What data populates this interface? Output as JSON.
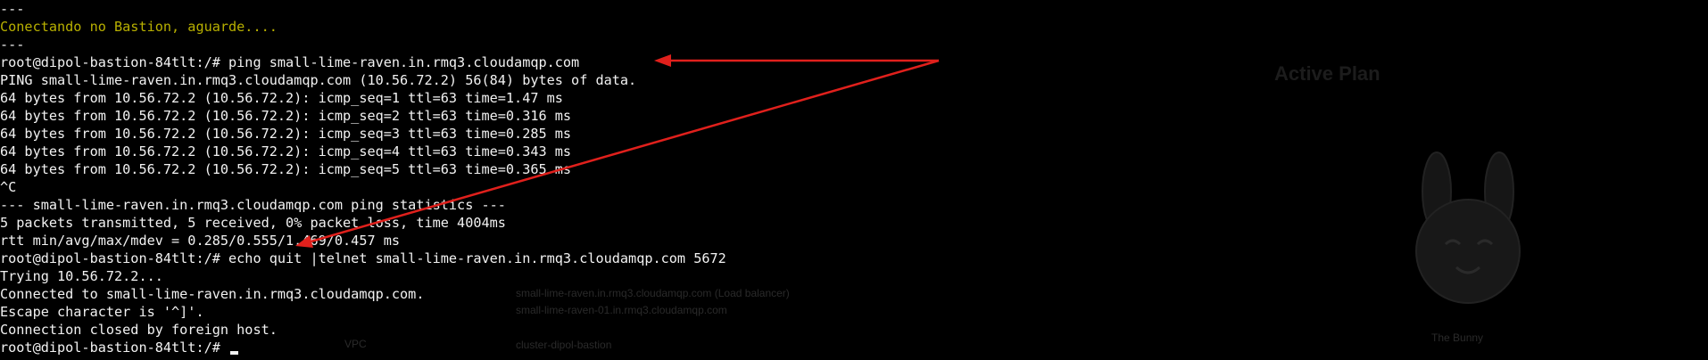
{
  "terminal": {
    "lines": [
      {
        "text": "---",
        "style": "normal"
      },
      {
        "text": "Conectando no Bastion, aguarde....",
        "style": "yellow"
      },
      {
        "text": "---",
        "style": "normal"
      },
      {
        "text": "root@dipol-bastion-84tlt:/# ping small-lime-raven.in.rmq3.cloudamqp.com",
        "style": "normal"
      },
      {
        "text": "PING small-lime-raven.in.rmq3.cloudamqp.com (10.56.72.2) 56(84) bytes of data.",
        "style": "normal"
      },
      {
        "text": "64 bytes from 10.56.72.2 (10.56.72.2): icmp_seq=1 ttl=63 time=1.47 ms",
        "style": "normal"
      },
      {
        "text": "64 bytes from 10.56.72.2 (10.56.72.2): icmp_seq=2 ttl=63 time=0.316 ms",
        "style": "normal"
      },
      {
        "text": "64 bytes from 10.56.72.2 (10.56.72.2): icmp_seq=3 ttl=63 time=0.285 ms",
        "style": "normal"
      },
      {
        "text": "64 bytes from 10.56.72.2 (10.56.72.2): icmp_seq=4 ttl=63 time=0.343 ms",
        "style": "normal"
      },
      {
        "text": "64 bytes from 10.56.72.2 (10.56.72.2): icmp_seq=5 ttl=63 time=0.365 ms",
        "style": "normal"
      },
      {
        "text": "^C",
        "style": "normal"
      },
      {
        "text": "--- small-lime-raven.in.rmq3.cloudamqp.com ping statistics ---",
        "style": "normal"
      },
      {
        "text": "5 packets transmitted, 5 received, 0% packet loss, time 4004ms",
        "style": "normal"
      },
      {
        "text": "rtt min/avg/max/mdev = 0.285/0.555/1.469/0.457 ms",
        "style": "normal"
      },
      {
        "text": "root@dipol-bastion-84tlt:/# echo quit |telnet small-lime-raven.in.rmq3.cloudamqp.com 5672",
        "style": "normal"
      },
      {
        "text": "Trying 10.56.72.2...",
        "style": "normal"
      },
      {
        "text": "Connected to small-lime-raven.in.rmq3.cloudamqp.com.",
        "style": "normal"
      },
      {
        "text": "Escape character is '^]'.",
        "style": "normal"
      },
      {
        "text": "Connection closed by foreign host.",
        "style": "normal"
      },
      {
        "text": "root@dipol-bastion-84tlt:/# ",
        "style": "prompt"
      }
    ]
  },
  "background_page": {
    "title": "Active Plan",
    "faint_texts": [
      "small-lime-raven.in.rmq3.cloudamqp.com (Load balancer)",
      "small-lime-raven-01.in.rmq3.cloudamqp.com",
      "VPC",
      "cluster-dipol-bastion",
      "The Bunny"
    ]
  },
  "colors": {
    "terminal_background": "#000000",
    "terminal_text": "#f2f2f2",
    "highlight_yellow": "#b8b000",
    "annotation_arrow": "#e0201c"
  },
  "annotations": {
    "arrow_color": "#e0201c",
    "count": 2
  }
}
